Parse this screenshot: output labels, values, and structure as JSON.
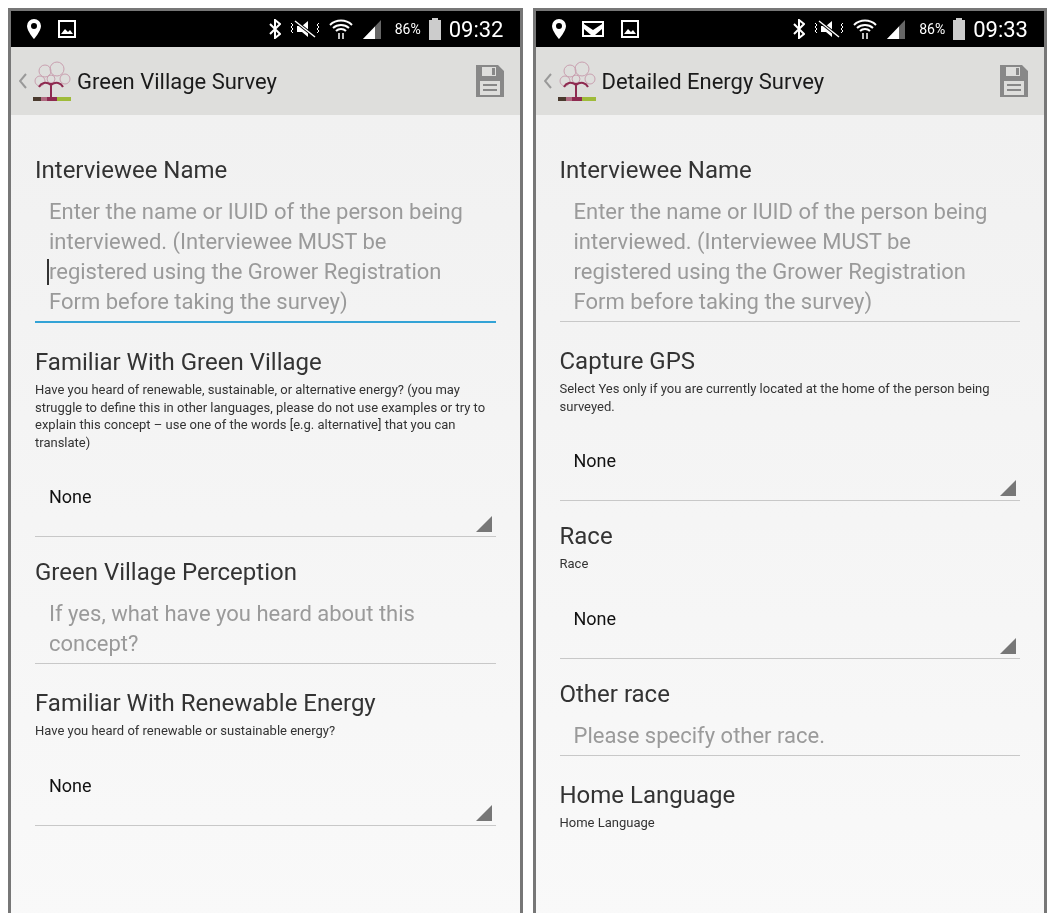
{
  "screens": [
    {
      "status_bar": {
        "notifications": [
          {
            "kind": "location"
          },
          {
            "kind": "image"
          }
        ],
        "battery": "86%",
        "time": "09:32"
      },
      "title": "Green Village Survey",
      "fields": [
        {
          "kind": "text",
          "label": "Interviewee Name",
          "placeholder": "Enter the name or IUID of the person being interviewed. (Interviewee MUST be registered using the Grower Registration Form before taking the survey)",
          "focused": true
        },
        {
          "kind": "select",
          "label": "Familiar With Green Village",
          "help": "Have you heard of renewable, sustainable, or alternative energy? (you may struggle to define this in other languages, please do not use examples or try to explain this concept – use one of the words [e.g. alternative] that you can translate)",
          "value": "None"
        },
        {
          "kind": "text",
          "label": "Green Village Perception",
          "placeholder": "If yes, what have you heard about this concept?",
          "focused": false
        },
        {
          "kind": "select",
          "label": "Familiar With Renewable Energy",
          "help": "Have you heard of renewable or sustainable energy?",
          "value": "None"
        }
      ]
    },
    {
      "status_bar": {
        "notifications": [
          {
            "kind": "location"
          },
          {
            "kind": "mail"
          },
          {
            "kind": "image"
          }
        ],
        "battery": "86%",
        "time": "09:33"
      },
      "title": "Detailed Energy Survey",
      "fields": [
        {
          "kind": "text",
          "label": "Interviewee Name",
          "placeholder": "Enter the name or IUID of the person being interviewed. (Interviewee MUST be registered using the Grower Registration Form before taking the survey)",
          "focused": false
        },
        {
          "kind": "select",
          "label": "Capture GPS",
          "help": "Select Yes only if you are currently located at the home of the person being surveyed.",
          "value": "None"
        },
        {
          "kind": "select",
          "label": "Race",
          "help": "Race",
          "value": "None"
        },
        {
          "kind": "text",
          "label": "Other race",
          "placeholder": "Please specify other race.",
          "focused": false
        },
        {
          "kind": "heading",
          "label": "Home Language",
          "help": "Home Language"
        }
      ]
    }
  ]
}
